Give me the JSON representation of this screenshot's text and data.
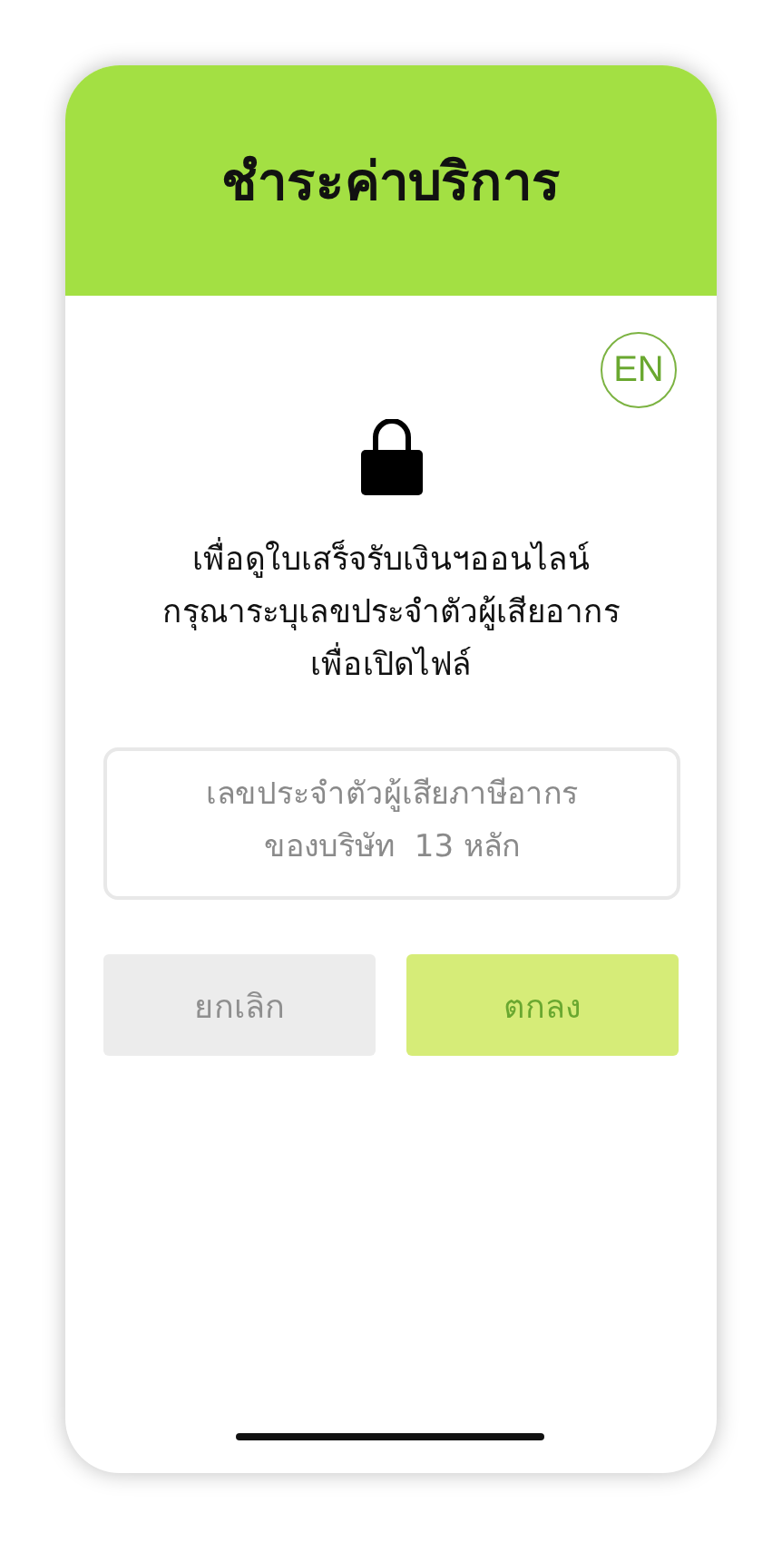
{
  "header": {
    "title": "ชำระค่าบริการ"
  },
  "language_button": {
    "label": "EN"
  },
  "message": "เพื่อดูใบเสร็จรับเงินฯออนไลน์\nกรุณาระบุเลขประจำตัวผู้เสียอากร\nเพื่อเปิดไฟล์",
  "tax_id_field": {
    "placeholder": "เลขประจำตัวผู้เสียภาษีอากร\nของบริษัท  13 หลัก"
  },
  "buttons": [
    {
      "label": "ยกเลิก",
      "kind": "cancel"
    },
    {
      "label": "ตกลง",
      "kind": "confirm"
    }
  ]
}
